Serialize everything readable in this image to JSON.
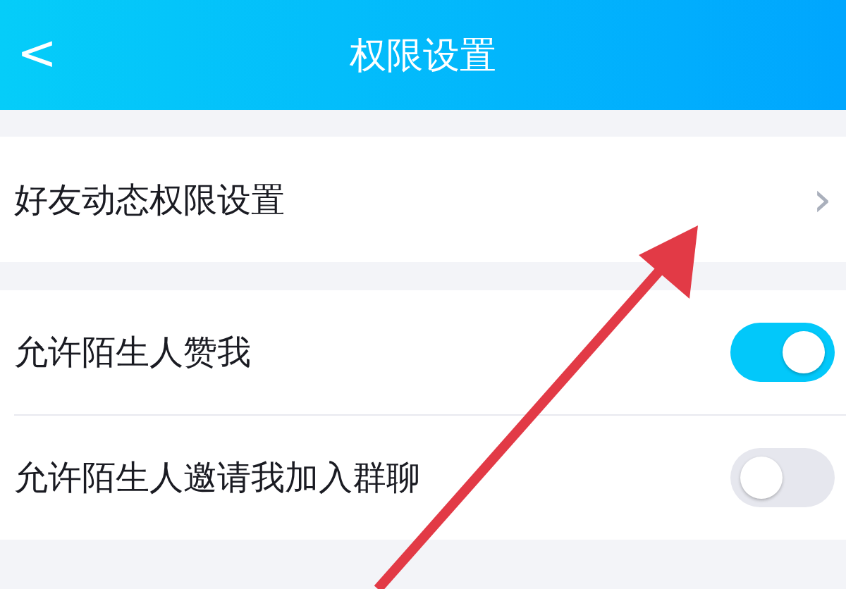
{
  "header": {
    "back": "<",
    "title": "权限设置"
  },
  "link_section": [
    {
      "label": "好友动态权限设置",
      "chevron": "›"
    }
  ],
  "toggle_section": [
    {
      "label": "允许陌生人赞我",
      "on": true
    },
    {
      "label": "允许陌生人邀请我加入群聊",
      "on": false
    }
  ]
}
